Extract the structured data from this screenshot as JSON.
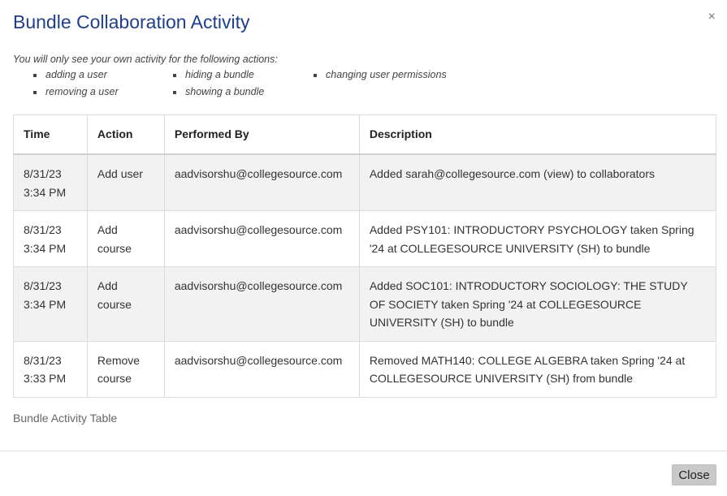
{
  "modal": {
    "title": "Bundle Collaboration Activity",
    "close_icon": "×",
    "note": "You will only see your own activity for the following actions:",
    "actions": [
      "adding a user",
      "removing a user",
      "hiding a bundle",
      "showing a bundle",
      "changing user permissions"
    ]
  },
  "table": {
    "headers": [
      "Time",
      "Action",
      "Performed By",
      "Description"
    ],
    "rows": [
      {
        "date": "8/31/23",
        "time": "3:34 PM",
        "action1": "Add user",
        "action2": "",
        "by": "aadvisorshu@collegesource.com",
        "description": "Added sarah@collegesource.com (view) to collaborators"
      },
      {
        "date": "8/31/23",
        "time": "3:34 PM",
        "action1": "Add",
        "action2": "course",
        "by": "aadvisorshu@collegesource.com",
        "description": "Added PSY101: INTRODUCTORY PSYCHOLOGY taken Spring '24 at COLLEGESOURCE UNIVERSITY (SH) to bundle"
      },
      {
        "date": "8/31/23",
        "time": "3:34 PM",
        "action1": "Add",
        "action2": "course",
        "by": "aadvisorshu@collegesource.com",
        "description": "Added SOC101: INTRODUCTORY SOCIOLOGY: THE STUDY OF SOCIETY taken Spring '24 at COLLEGESOURCE UNIVERSITY (SH) to bundle"
      },
      {
        "date": "8/31/23",
        "time": "3:33 PM",
        "action1": "Remove",
        "action2": "course",
        "by": "aadvisorshu@collegesource.com",
        "description": "Removed MATH140: COLLEGE ALGEBRA taken Spring '24 at COLLEGESOURCE UNIVERSITY (SH) from bundle"
      }
    ],
    "caption": "Bundle Activity Table"
  },
  "footer": {
    "close_label": "Close"
  },
  "colors": {
    "title": "#1f3f8a",
    "row_stripe": "#f2f2f2",
    "button_bg": "#c9c9c9"
  }
}
